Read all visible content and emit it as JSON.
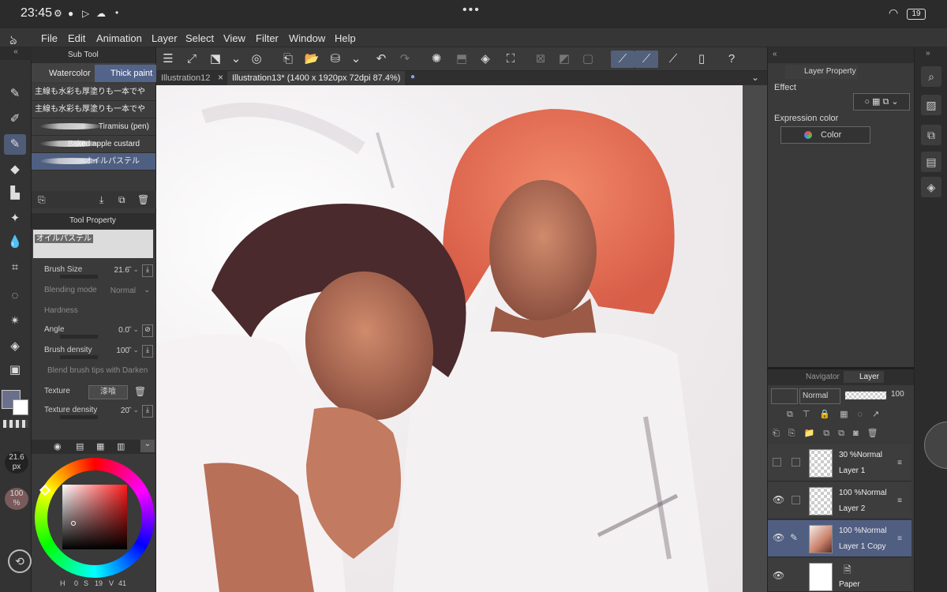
{
  "status_bar": {
    "time": "23:45",
    "battery": "19",
    "icons": [
      "settings-icon",
      "person-icon",
      "play-icon",
      "cloud-icon"
    ]
  },
  "menu": {
    "items": [
      "File",
      "Edit",
      "Animation",
      "Layer",
      "Select",
      "View",
      "Filter",
      "Window",
      "Help"
    ]
  },
  "sub_tool": {
    "panel_title": "Sub Tool",
    "tabs": [
      "Watercolor",
      "Thick paint"
    ],
    "brushes": [
      "主線も水彩も厚塗りも一本でや",
      "主線も水彩も厚塗りも一本でや",
      "Tiramisu (pen)",
      "Baked apple custard",
      "オイルパステル"
    ]
  },
  "tool_property": {
    "panel_title": "Tool Property",
    "brush_name": "オイルパステル",
    "brush_size_label": "Brush Size",
    "brush_size": "21.6",
    "blending_label": "Blending mode",
    "blending_value": "Normal",
    "hardness_label": "Hardness",
    "angle_label": "Angle",
    "angle": "0.0",
    "density_label": "Brush density",
    "density": "100",
    "blend_tips_label": "Blend brush tips with Darken",
    "texture_label": "Texture",
    "texture_value": "漆喰",
    "texture_density_label": "Texture density",
    "texture_density": "20"
  },
  "left_indicators": {
    "size": "21.6",
    "size_unit": "px",
    "opacity": "100",
    "opacity_unit": "%"
  },
  "color_status": {
    "h": "0",
    "s": "19",
    "v": "41",
    "labels": [
      "H",
      "S",
      "V"
    ]
  },
  "document_tabs": [
    "Illustration12",
    "Illustration13* (1400 x 1920px 72dpi 87.4%)"
  ],
  "layer_property": {
    "title": "Layer Property",
    "effect_label": "Effect",
    "expression_label": "Expression color",
    "expression_value": "Color"
  },
  "layer_panel": {
    "tabs": [
      "Navigator",
      "Layer"
    ],
    "blend_mode": "Normal",
    "opacity": "100",
    "layers": [
      {
        "opacity": "30 %Normal",
        "name": "Layer 1"
      },
      {
        "opacity": "100 %Normal",
        "name": "Layer 2"
      },
      {
        "opacity": "100 %Normal",
        "name": "Layer 1 Copy"
      },
      {
        "opacity": "",
        "name": "Paper"
      }
    ]
  },
  "colors": {
    "main_color": "#6a6f8c",
    "accent": "#53648a",
    "selected_layer": "#505e82"
  }
}
